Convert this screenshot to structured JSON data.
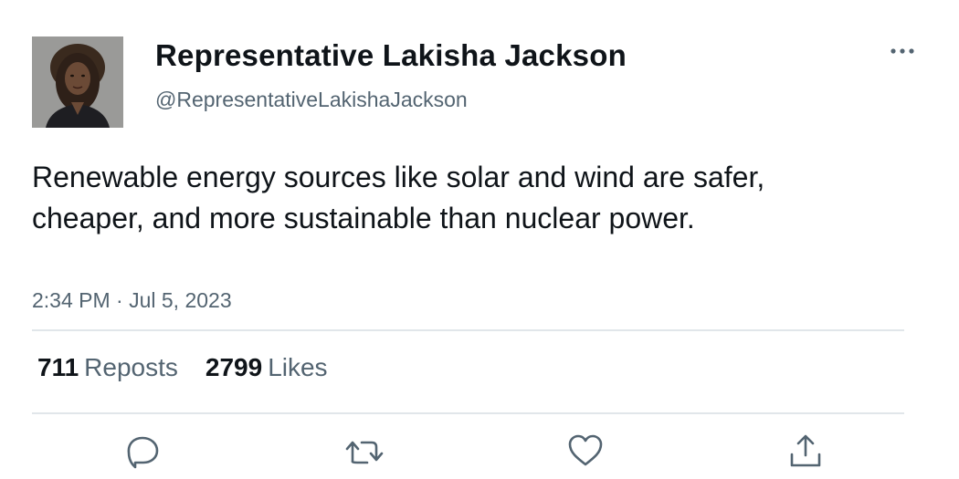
{
  "tweet": {
    "display_name": "Representative Lakisha Jackson",
    "handle": "@RepresentativeLakishaJackson",
    "text": "Renewable energy sources like solar and wind are safer, cheaper, and more sustainable than nuclear power.",
    "timestamp": "2:34 PM · Jul 5, 2023",
    "avatar_icon": "profile-photo"
  },
  "stats": {
    "reposts_count": "711",
    "reposts_label": "Reposts",
    "likes_count": "2799",
    "likes_label": "Likes"
  },
  "actions": {
    "icons": [
      "reply-icon",
      "repost-icon",
      "like-icon",
      "share-icon"
    ],
    "icon_color": "#536471"
  },
  "colors": {
    "text_primary": "#0f1419",
    "text_secondary": "#536471",
    "divider": "#e1e6ea"
  }
}
